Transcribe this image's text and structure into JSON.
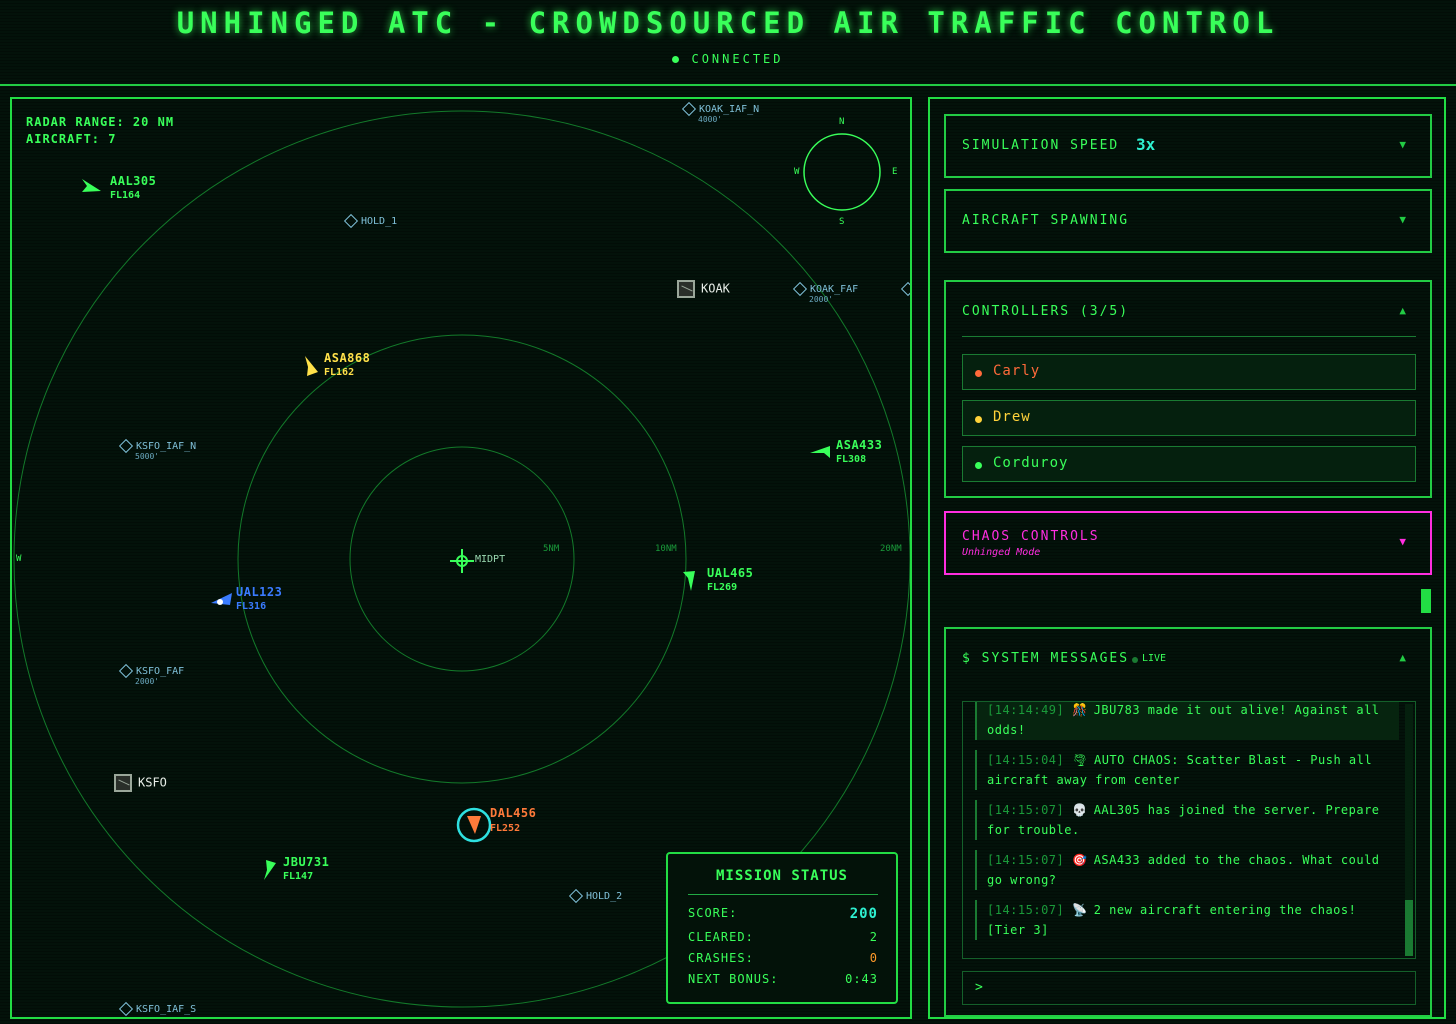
{
  "header": {
    "title": "UNHINGED ATC - CROWDSOURCED AIR TRAFFIC CONTROL",
    "status": "CONNECTED"
  },
  "radar": {
    "range_label": "RADAR RANGE: 20 NM",
    "aircraft_label": "AIRCRAFT: 7",
    "ring_labels": [
      "5NM",
      "10NM",
      "20NM"
    ],
    "center_fix": "MIDPT",
    "edge_label_w": "W",
    "compass": {
      "n": "N",
      "s": "S",
      "e": "E",
      "w": "W"
    },
    "fixes": [
      {
        "name": "KOAK_IAF_N",
        "alt": "4000'"
      },
      {
        "name": "HOLD_1",
        "alt": ""
      },
      {
        "name": "KOAK_FAF",
        "alt": "2000'"
      },
      {
        "name": "KSFO_IAF_N",
        "alt": "5000'"
      },
      {
        "name": "KSFO_FAF",
        "alt": "2000'"
      },
      {
        "name": "HOLD_2",
        "alt": ""
      },
      {
        "name": "KSFO_IAF_S",
        "alt": ""
      }
    ],
    "airports": [
      "KOAK",
      "KSFO"
    ],
    "aircraft": [
      {
        "callsign": "AAL305",
        "fl": "FL164",
        "color": "#39ff5a"
      },
      {
        "callsign": "ASA868",
        "fl": "FL162",
        "color": "#ffe14a"
      },
      {
        "callsign": "ASA433",
        "fl": "FL308",
        "color": "#39ff5a"
      },
      {
        "callsign": "UAL123",
        "fl": "FL316",
        "color": "#3a7bff"
      },
      {
        "callsign": "UAL465",
        "fl": "FL269",
        "color": "#39ff5a"
      },
      {
        "callsign": "DAL456",
        "fl": "FL252",
        "color": "#ff7a3a"
      },
      {
        "callsign": "JBU731",
        "fl": "FL147",
        "color": "#39ff5a"
      }
    ]
  },
  "mission": {
    "title": "MISSION STATUS",
    "rows": [
      {
        "label": "SCORE:",
        "value": "200",
        "color": "#2ef0d0"
      },
      {
        "label": "CLEARED:",
        "value": "2",
        "color": "#39ff5a"
      },
      {
        "label": "CRASHES:",
        "value": "0",
        "color": "#ff9a2a"
      },
      {
        "label": "NEXT BONUS:",
        "value": "0:43",
        "color": "#39ff5a"
      }
    ]
  },
  "panel": {
    "sim_speed": {
      "label": "SIMULATION SPEED",
      "value": "3x"
    },
    "spawning": {
      "label": "AIRCRAFT SPAWNING"
    },
    "controllers": {
      "label": "CONTROLLERS (3/5)",
      "items": [
        {
          "name": "Carly",
          "color": "#ff6a3a"
        },
        {
          "name": "Drew",
          "color": "#ffd23a"
        },
        {
          "name": "Corduroy",
          "color": "#39ff5a"
        }
      ]
    },
    "chaos": {
      "label": "CHAOS CONTROLS",
      "sub": "Unhinged Mode",
      "color": "#ff2ee0"
    },
    "messages": {
      "label": "$ SYSTEM MESSAGES",
      "live": "LIVE",
      "prompt": ">",
      "items": [
        {
          "ts": "[14:14:49]",
          "icon": "🎊",
          "text": "JBU783 made it out alive! Against all odds!"
        },
        {
          "ts": "[14:15:04]",
          "icon": "🌪",
          "text": "AUTO CHAOS: Scatter Blast - Push all aircraft away from center"
        },
        {
          "ts": "[14:15:07]",
          "icon": "💀",
          "text": "AAL305 has joined the server. Prepare for trouble."
        },
        {
          "ts": "[14:15:07]",
          "icon": "🎯",
          "text": "ASA433 added to the chaos. What could go wrong?"
        },
        {
          "ts": "[14:15:07]",
          "icon": "📡",
          "text": "2 new aircraft entering the chaos! [Tier 3]"
        }
      ]
    }
  }
}
